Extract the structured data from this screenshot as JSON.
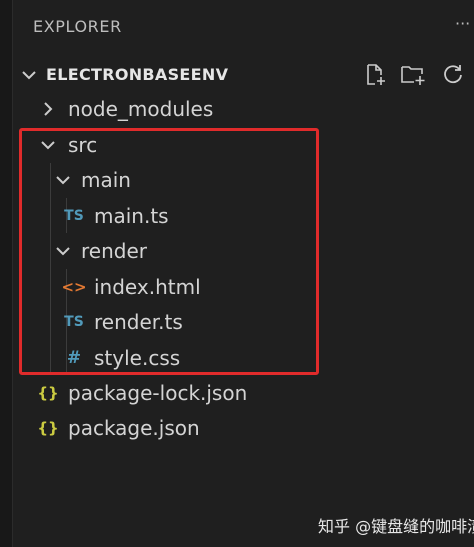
{
  "explorer": {
    "title": "EXPLORER",
    "more_actions": "···"
  },
  "section": {
    "title": "ELECTRONBASEENV",
    "actions": [
      "new-file-icon",
      "new-folder-icon",
      "refresh-icon"
    ]
  },
  "tree": [
    {
      "label": "node_modules",
      "type": "folder",
      "expanded": false
    },
    {
      "label": "src",
      "type": "folder",
      "expanded": true
    },
    {
      "label": "main",
      "type": "folder",
      "expanded": true
    },
    {
      "label": "main.ts",
      "type": "file",
      "icon_text": "TS",
      "icon_color": "#519aba"
    },
    {
      "label": "render",
      "type": "folder",
      "expanded": true
    },
    {
      "label": "index.html",
      "type": "file",
      "icon_text": "<>",
      "icon_color": "#e37933"
    },
    {
      "label": "render.ts",
      "type": "file",
      "icon_text": "TS",
      "icon_color": "#519aba"
    },
    {
      "label": "style.css",
      "type": "file",
      "icon_text": "#",
      "icon_color": "#519aba"
    },
    {
      "label": "package-lock.json",
      "type": "file",
      "icon_text": "{}",
      "icon_color": "#cbcb41"
    },
    {
      "label": "package.json",
      "type": "file",
      "icon_text": "{}",
      "icon_color": "#cbcb41"
    }
  ],
  "highlight_color": "#e02b2b",
  "watermark": "知乎 @键盘缝的咖啡渍"
}
